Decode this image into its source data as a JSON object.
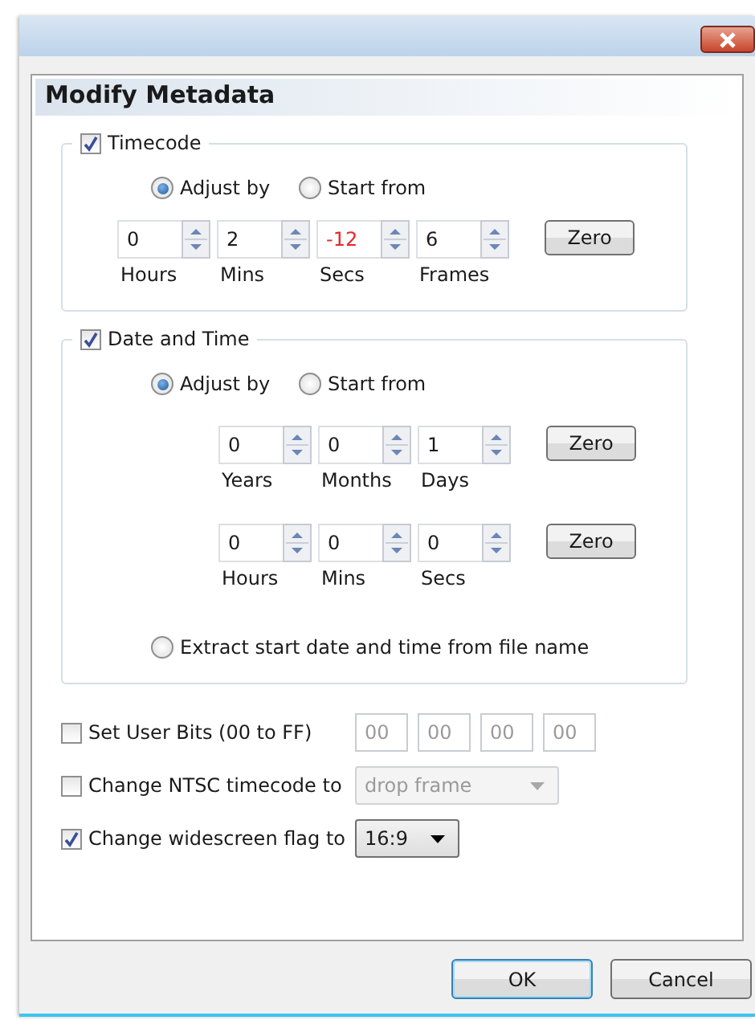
{
  "dialog": {
    "title": "Modify Metadata"
  },
  "timecode": {
    "label": "Timecode",
    "checked": true,
    "modes": [
      {
        "label": "Adjust by",
        "selected": true
      },
      {
        "label": "Start from",
        "selected": false
      }
    ],
    "spinner_rows": [
      {
        "fields": [
          {
            "value": "0",
            "label": "Hours",
            "negative": false
          },
          {
            "value": "2",
            "label": "Mins",
            "negative": false
          },
          {
            "value": "-12",
            "label": "Secs",
            "negative": true
          },
          {
            "value": "6",
            "label": "Frames",
            "negative": false
          }
        ],
        "button": "Zero"
      }
    ]
  },
  "date_time": {
    "label": "Date and Time",
    "checked": true,
    "modes": [
      {
        "label": "Adjust by",
        "selected": true
      },
      {
        "label": "Start from",
        "selected": false
      }
    ],
    "spinner_rows": [
      {
        "fields": [
          {
            "value": "0",
            "label": "Years",
            "negative": false
          },
          {
            "value": "0",
            "label": "Months",
            "negative": false
          },
          {
            "value": "1",
            "label": "Days",
            "negative": false
          }
        ],
        "button": "Zero"
      },
      {
        "fields": [
          {
            "value": "0",
            "label": "Hours",
            "negative": false
          },
          {
            "value": "0",
            "label": "Mins",
            "negative": false
          },
          {
            "value": "0",
            "label": "Secs",
            "negative": false
          }
        ],
        "button": "Zero"
      }
    ],
    "extract_option": {
      "label": "Extract start date and time from file name",
      "selected": false
    }
  },
  "options": [
    {
      "kind": "bits",
      "label": "Set User Bits (00 to FF)",
      "checked": false,
      "fields": [
        "00",
        "00",
        "00",
        "00"
      ]
    },
    {
      "kind": "dropdown",
      "label": "Change NTSC timecode to",
      "checked": false,
      "value": "drop frame"
    },
    {
      "kind": "dropdown",
      "label": "Change widescreen flag to",
      "checked": true,
      "value": "16:9"
    }
  ],
  "buttons": [
    {
      "label": "OK",
      "default": true
    },
    {
      "label": "Cancel",
      "default": false
    }
  ]
}
